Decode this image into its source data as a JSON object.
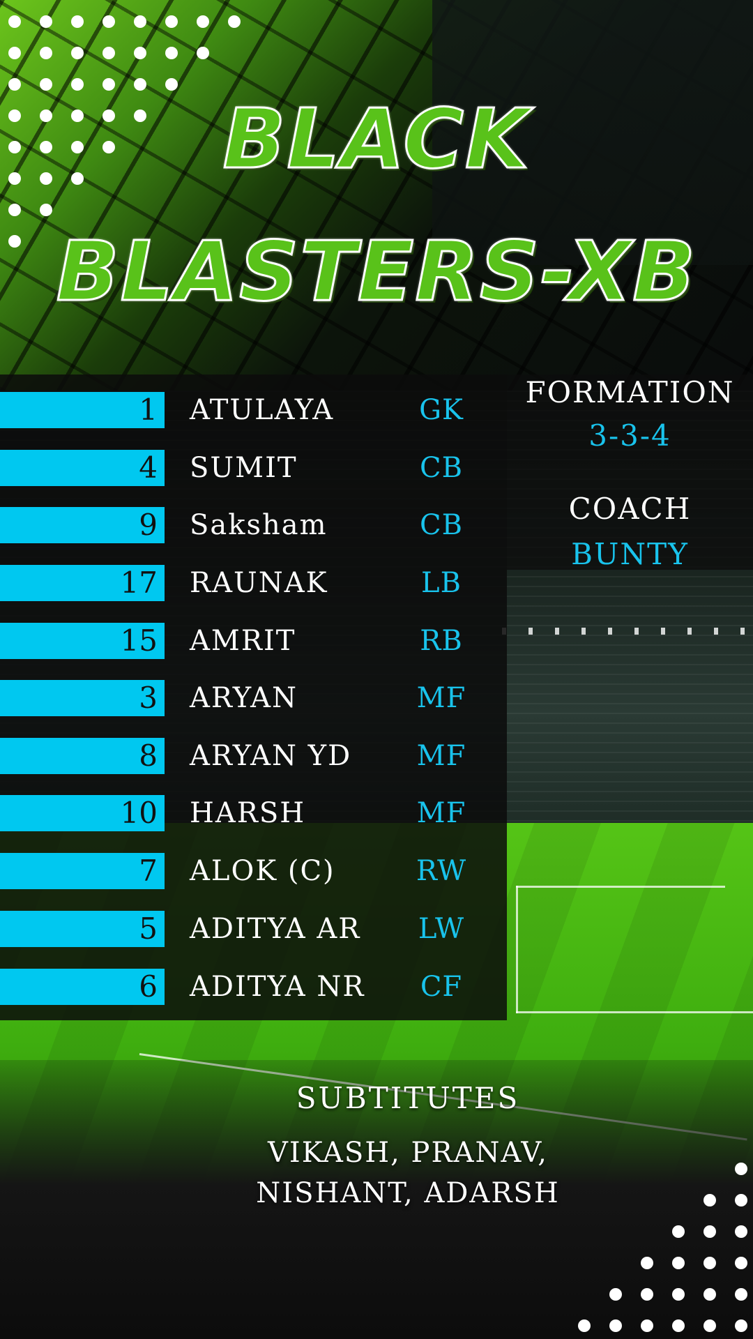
{
  "team": {
    "name_line1": "BLACK",
    "name_line2": "BLASTERS-XB"
  },
  "players": [
    {
      "number": "1",
      "name": "ATULAYA",
      "position": "GK"
    },
    {
      "number": "4",
      "name": "SUMIT",
      "position": "CB"
    },
    {
      "number": "9",
      "name": "Saksham",
      "position": "CB"
    },
    {
      "number": "17",
      "name": "RAUNAK",
      "position": "LB"
    },
    {
      "number": "15",
      "name": "AMRIT",
      "position": "RB"
    },
    {
      "number": "3",
      "name": "ARYAN",
      "position": "MF"
    },
    {
      "number": "8",
      "name": "ARYAN YD",
      "position": "MF"
    },
    {
      "number": "10",
      "name": "HARSH",
      "position": "MF"
    },
    {
      "number": "7",
      "name": "ALOK (C)",
      "position": "RW"
    },
    {
      "number": "5",
      "name": "ADITYA AR",
      "position": "LW"
    },
    {
      "number": "6",
      "name": "ADITYA NR",
      "position": "CF"
    }
  ],
  "formation": {
    "label": "FORMATION",
    "value": "3-3-4"
  },
  "coach": {
    "label": "COACH",
    "value": "BUNTY"
  },
  "substitutes": {
    "label": "SUBTITUTES",
    "line1": "VIKASH, PRANAV,",
    "line2": "NISHANT, ADARSH"
  },
  "colors": {
    "accent": "#00c8f0",
    "title_green": "#59c21a",
    "panel": "#0c0c0c",
    "text": "#ffffff"
  }
}
